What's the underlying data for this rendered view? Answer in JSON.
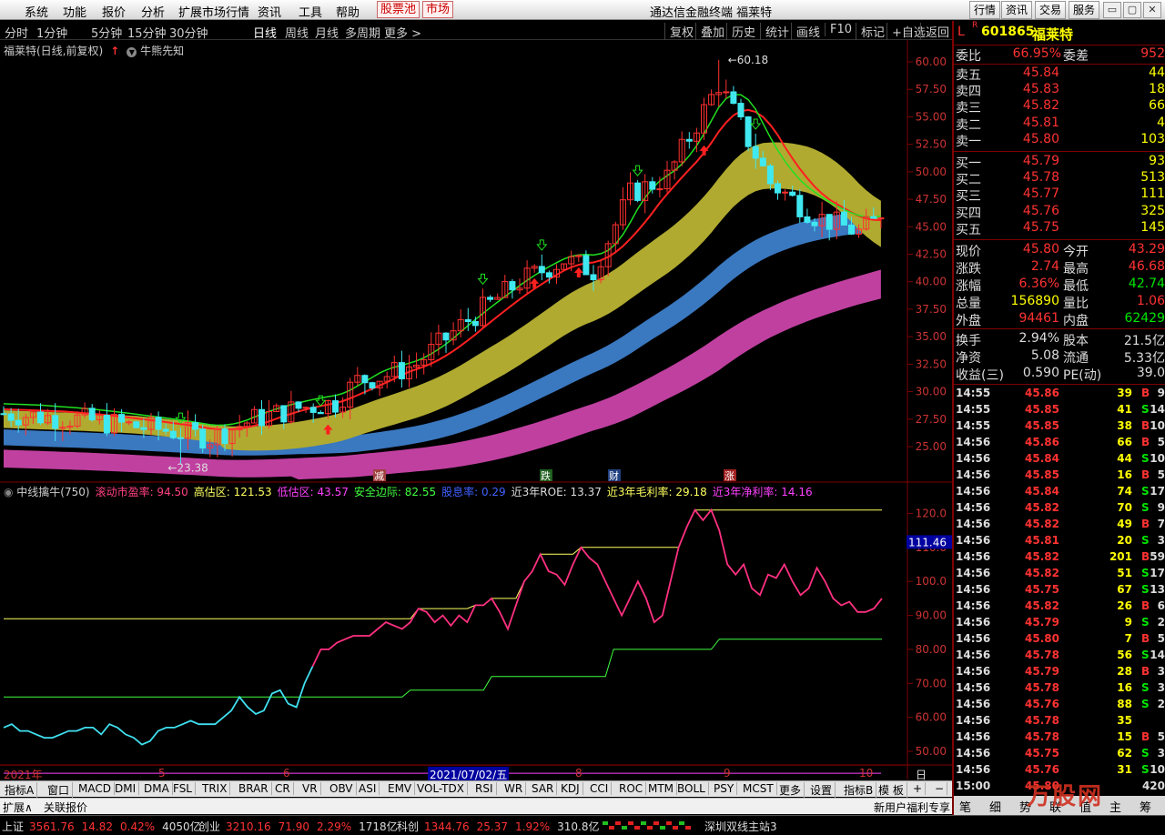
{
  "menu": {
    "items": [
      "系统",
      "功能",
      "报价",
      "分析",
      "扩展市场行情",
      "资讯",
      "工具",
      "帮助"
    ],
    "stock_pool": "股票池",
    "market": "市场",
    "app_title": "通达信金融终端  福莱特",
    "right_buttons": [
      "行情",
      "资讯",
      "交易",
      "服务"
    ]
  },
  "periods": [
    "分时",
    "1分钟",
    "5分钟",
    "15分钟",
    "30分钟",
    "日线",
    "周线",
    "月线",
    "多周期",
    "更多 >"
  ],
  "selected_period": "日线",
  "toolbar_right": [
    "复权",
    "叠加",
    "历史",
    "统计",
    "画线",
    "F10",
    "标记",
    "+自选",
    "返回"
  ],
  "chart": {
    "header": "福莱特(日线,前复权)",
    "tool_label": "牛熊先知",
    "high_marker": "60.18",
    "low_marker": "23.38",
    "price_ticks": [
      "60.00",
      "57.50",
      "55.00",
      "52.50",
      "50.00",
      "47.50",
      "45.00",
      "42.50",
      "40.00",
      "37.50",
      "35.00",
      "32.50",
      "30.00",
      "27.50",
      "25.00"
    ],
    "event_markers": [
      "减",
      "跌",
      "财",
      "涨"
    ],
    "date_labels": [
      "2021年",
      "5",
      "6",
      "2021/07/02/五",
      "8",
      "9",
      "10"
    ],
    "period_corner": "日线"
  },
  "indicator": {
    "name": "中线擒牛(750)",
    "items": [
      {
        "label": "滚动市盈率: 94.50",
        "color": "#ff4080"
      },
      {
        "label": "高估区: 121.53",
        "color": "#ffff60"
      },
      {
        "label": "低估区: 43.57",
        "color": "#ff40ff"
      },
      {
        "label": "安全边际: 82.55",
        "color": "#40ff40"
      },
      {
        "label": "股息率: 0.29",
        "color": "#4060ff"
      },
      {
        "label": "近3年ROE: 13.37",
        "color": "#dddddd"
      },
      {
        "label": "近3年毛利率: 29.18",
        "color": "#ffff60"
      },
      {
        "label": "近3年净利率: 14.16",
        "color": "#ff40ff"
      }
    ],
    "ticks": [
      "120.0",
      "110.0",
      "100.0",
      "90.00",
      "80.00",
      "70.00",
      "60.00",
      "50.00"
    ],
    "current_value": "111.46"
  },
  "tabs": [
    "指标A",
    "窗口",
    "MACD",
    "DMI",
    "DMA",
    "FSL",
    "TRIX",
    "BRAR",
    "CR",
    "VR",
    "OBV",
    "ASI",
    "EMV",
    "VOL-TDX",
    "RSI",
    "WR",
    "SAR",
    "KDJ",
    "CCI",
    "ROC",
    "MTM",
    "BOLL",
    "PSY",
    "MCST",
    "更多",
    "设置"
  ],
  "tabs_right": [
    "指标B",
    "模 板",
    "+",
    "−"
  ],
  "ext": [
    "扩展∧",
    "关联报价"
  ],
  "ext_right": "新用户福利专享",
  "status": {
    "index": [
      {
        "name": "上证",
        "value": "3561.76",
        "change": "14.82",
        "pct": "0.42%",
        "amount": "4050亿"
      },
      {
        "name": "创业",
        "value": "3210.16",
        "change": "71.90",
        "pct": "2.29%",
        "amount": "1718亿"
      },
      {
        "name": "科创",
        "value": "1344.76",
        "change": "25.37",
        "pct": "1.92%",
        "amount": "310.8亿"
      }
    ],
    "server": "深圳双线主站3"
  },
  "quote": {
    "tag": "L",
    "rtag": "R",
    "code": "601865",
    "name": "福莱特",
    "wb_label": "委比",
    "wb_value": "66.95%",
    "wc_label": "委差",
    "wc_value": "952",
    "asks": [
      {
        "label": "卖五",
        "price": "45.84",
        "vol": "44"
      },
      {
        "label": "卖四",
        "price": "45.83",
        "vol": "18"
      },
      {
        "label": "卖三",
        "price": "45.82",
        "vol": "66"
      },
      {
        "label": "卖二",
        "price": "45.81",
        "vol": "4"
      },
      {
        "label": "卖一",
        "price": "45.80",
        "vol": "103"
      }
    ],
    "bids": [
      {
        "label": "买一",
        "price": "45.79",
        "vol": "93"
      },
      {
        "label": "买二",
        "price": "45.78",
        "vol": "513"
      },
      {
        "label": "买三",
        "price": "45.77",
        "vol": "111"
      },
      {
        "label": "买四",
        "price": "45.76",
        "vol": "325"
      },
      {
        "label": "买五",
        "price": "45.75",
        "vol": "145"
      }
    ],
    "stats1": [
      {
        "l1": "现价",
        "v1": "45.80",
        "c1": "up",
        "l2": "今开",
        "v2": "43.29",
        "c2": "up"
      },
      {
        "l1": "涨跌",
        "v1": "2.74",
        "c1": "up",
        "l2": "最高",
        "v2": "46.68",
        "c2": "up"
      },
      {
        "l1": "涨幅",
        "v1": "6.36%",
        "c1": "up",
        "l2": "最低",
        "v2": "42.74",
        "c2": "dn"
      },
      {
        "l1": "总量",
        "v1": "156890",
        "c1": "yl",
        "l2": "量比",
        "v2": "1.06",
        "c2": "up"
      },
      {
        "l1": "外盘",
        "v1": "94461",
        "c1": "up",
        "l2": "内盘",
        "v2": "62429",
        "c2": "dn"
      }
    ],
    "stats2": [
      {
        "l1": "换手",
        "v1": "2.94%",
        "l2": "股本",
        "v2": "21.5亿"
      },
      {
        "l1": "净资",
        "v1": "5.08",
        "l2": "流通",
        "v2": "5.33亿"
      },
      {
        "l1": "收益(三)",
        "v1": "0.590",
        "l2": "PE(动)",
        "v2": "39.0"
      }
    ],
    "ticks": [
      {
        "t": "14:55",
        "p": "45.86",
        "v": "39",
        "s": "B",
        "n": "9"
      },
      {
        "t": "14:55",
        "p": "45.85",
        "v": "41",
        "s": "S",
        "n": "14"
      },
      {
        "t": "14:55",
        "p": "45.85",
        "v": "38",
        "s": "B",
        "n": "10"
      },
      {
        "t": "14:56",
        "p": "45.86",
        "v": "66",
        "s": "B",
        "n": "5"
      },
      {
        "t": "14:56",
        "p": "45.84",
        "v": "44",
        "s": "S",
        "n": "10"
      },
      {
        "t": "14:56",
        "p": "45.85",
        "v": "16",
        "s": "B",
        "n": "5"
      },
      {
        "t": "14:56",
        "p": "45.84",
        "v": "74",
        "s": "S",
        "n": "17"
      },
      {
        "t": "14:56",
        "p": "45.82",
        "v": "70",
        "s": "S",
        "n": "9"
      },
      {
        "t": "14:56",
        "p": "45.82",
        "v": "49",
        "s": "B",
        "n": "7"
      },
      {
        "t": "14:56",
        "p": "45.81",
        "v": "20",
        "s": "S",
        "n": "3"
      },
      {
        "t": "14:56",
        "p": "45.82",
        "v": "201",
        "s": "B",
        "n": "59"
      },
      {
        "t": "14:56",
        "p": "45.82",
        "v": "51",
        "s": "S",
        "n": "17"
      },
      {
        "t": "14:56",
        "p": "45.75",
        "v": "67",
        "s": "S",
        "n": "13"
      },
      {
        "t": "14:56",
        "p": "45.82",
        "v": "26",
        "s": "B",
        "n": "6"
      },
      {
        "t": "14:56",
        "p": "45.79",
        "v": "9",
        "s": "S",
        "n": "2"
      },
      {
        "t": "14:56",
        "p": "45.80",
        "v": "7",
        "s": "B",
        "n": "5"
      },
      {
        "t": "14:56",
        "p": "45.78",
        "v": "56",
        "s": "S",
        "n": "14"
      },
      {
        "t": "14:56",
        "p": "45.79",
        "v": "28",
        "s": "B",
        "n": "3"
      },
      {
        "t": "14:56",
        "p": "45.78",
        "v": "16",
        "s": "S",
        "n": "3"
      },
      {
        "t": "14:56",
        "p": "45.76",
        "v": "88",
        "s": "S",
        "n": "2"
      },
      {
        "t": "14:56",
        "p": "45.78",
        "v": "35",
        "s": "",
        "n": ""
      },
      {
        "t": "14:56",
        "p": "45.78",
        "v": "15",
        "s": "B",
        "n": "5"
      },
      {
        "t": "14:56",
        "p": "45.75",
        "v": "62",
        "s": "S",
        "n": "3"
      },
      {
        "t": "14:56",
        "p": "45.76",
        "v": "31",
        "s": "S",
        "n": "10"
      },
      {
        "t": "15:00",
        "p": "45.80",
        "v": "",
        "s": "",
        "n": "420"
      }
    ],
    "bottom_tabs": [
      "笔",
      "细",
      "势",
      "联",
      "值",
      "主",
      "筹"
    ],
    "watermark": "万股网"
  },
  "chart_data": {
    "type": "candlestick",
    "title": "福莱特(日线,前复权)",
    "y_range": [
      23.38,
      60.18
    ],
    "high": 60.18,
    "low": 23.38,
    "last_close": 45.8,
    "indicator_series": {
      "name": "滚动市盈率",
      "approx_path": [
        57,
        58,
        56,
        56,
        55,
        54,
        54,
        55,
        56,
        56,
        57,
        57,
        55,
        58,
        57,
        55,
        54,
        52,
        53,
        56,
        57,
        57,
        58,
        59,
        58,
        58,
        58,
        60,
        62,
        66,
        63,
        61,
        62,
        67,
        68,
        64,
        63,
        70,
        75,
        80,
        80,
        82,
        83,
        84,
        84,
        84,
        86,
        88,
        87,
        86,
        88,
        92,
        91,
        88,
        90,
        87,
        90,
        88,
        93,
        93,
        95,
        91,
        86,
        93,
        100,
        103,
        108,
        103,
        102,
        99,
        105,
        110,
        107,
        105,
        100,
        95,
        90,
        95,
        100,
        95,
        88,
        90,
        100,
        110,
        116,
        121,
        118,
        121,
        115,
        105,
        102,
        105,
        98,
        96,
        102,
        101,
        105,
        100,
        96,
        98,
        104,
        100,
        95,
        93,
        94,
        91,
        91,
        92,
        95
      ],
      "high_zone": 121.53,
      "low_zone": 43.57,
      "safety_margin": 82.55
    }
  }
}
